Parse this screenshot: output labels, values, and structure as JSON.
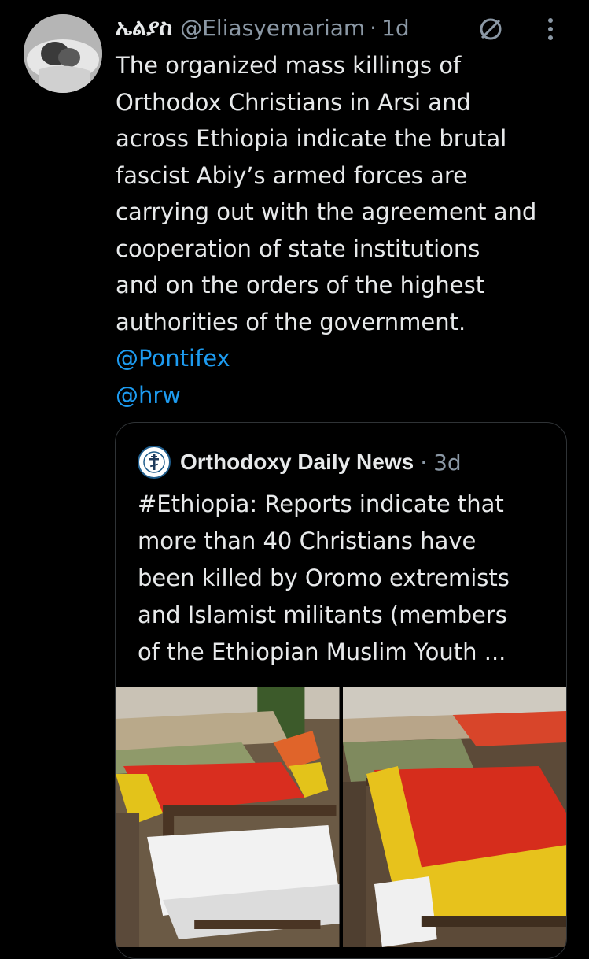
{
  "tweet": {
    "display_name": "ኤልያስ",
    "handle": "@Eliasyemariam",
    "separator": "·",
    "time": "1d",
    "text_lines": [
      "The organized mass killings of",
      "Orthodox Christians in Arsi and",
      "across Ethiopia indicate the brutal",
      "fascist Abiy’s armed forces are",
      "carrying out with the agreement and",
      "cooperation of state institutions",
      "and on the orders of the highest",
      "authorities of the government."
    ],
    "mentions": [
      "@Pontifex",
      "@hrw"
    ],
    "icons": {
      "status": "no-entry-icon",
      "menu": "more-vertical-icon"
    }
  },
  "quote": {
    "display_name": "Orthodoxy Daily News",
    "separator": "·",
    "time": "3d",
    "text_lines": [
      "#Ethiopia: Reports indicate that",
      "more than 40 Christians have",
      "been killed by Oromo extremists",
      "and Islamist militants (members",
      "of the Ethiopian Muslim Youth ..."
    ],
    "media_count": 2
  },
  "colors": {
    "background": "#000000",
    "text": "#e7e9ea",
    "secondary": "#8b98a5",
    "link": "#1d9bf0",
    "border": "#2f3336"
  }
}
